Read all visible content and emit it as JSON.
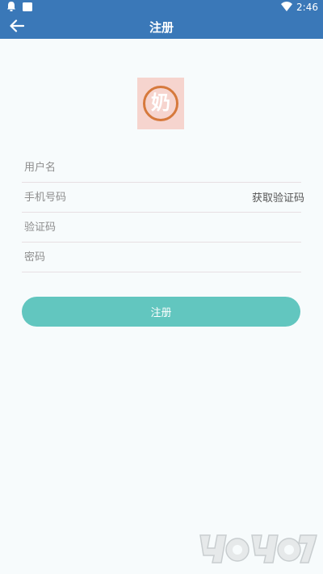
{
  "status_bar": {
    "time": "2:46",
    "icons": [
      "notification-icon",
      "sim-icon",
      "wifi-icon"
    ]
  },
  "app_bar": {
    "title": "注册",
    "back_icon": "arrow-left-icon"
  },
  "logo": {
    "character": "奶",
    "background_color": "#f6d4ce",
    "ring_color": "#d6793c"
  },
  "form": {
    "username_placeholder": "用户名",
    "phone_placeholder": "手机号码",
    "get_code_label": "获取验证码",
    "code_placeholder": "验证码",
    "password_placeholder": "密码",
    "submit_label": "注册"
  },
  "colors": {
    "app_bar": "#3a78b8",
    "primary_button": "#62c6bf",
    "background": "#f7fbfc"
  }
}
